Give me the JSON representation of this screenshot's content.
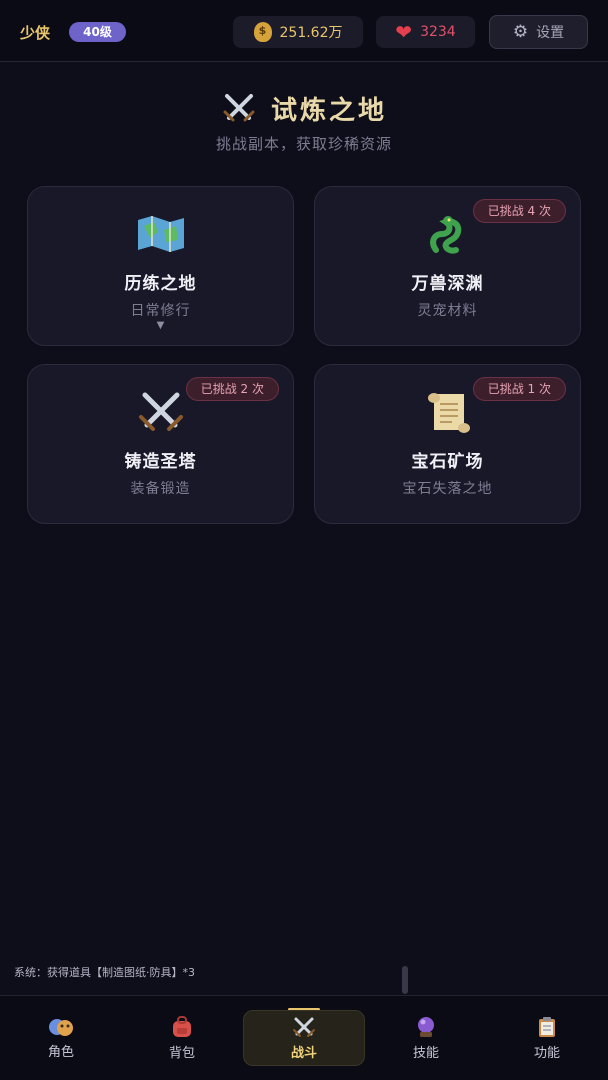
{
  "header": {
    "player_name": "少侠",
    "level": "40级",
    "gold": "251.62万",
    "hp": "3234",
    "settings_label": "设置"
  },
  "page": {
    "title": "试炼之地",
    "subtitle": "挑战副本，获取珍稀资源"
  },
  "cards": [
    {
      "title": "历练之地",
      "subtitle": "日常修行",
      "badge": "",
      "icon": "map-icon",
      "arrow": "▼"
    },
    {
      "title": "万兽深渊",
      "subtitle": "灵宠材料",
      "badge": "已挑战 4 次",
      "icon": "dragon-icon"
    },
    {
      "title": "铸造圣塔",
      "subtitle": "装备锻造",
      "badge": "已挑战 2 次",
      "icon": "crossed-swords-icon"
    },
    {
      "title": "宝石矿场",
      "subtitle": "宝石失落之地",
      "badge": "已挑战 1 次",
      "icon": "scroll-icon"
    }
  ],
  "system_log": "系统：获得道具【制造图纸·防具】*3",
  "nav": [
    {
      "label": "角色",
      "icon": "mask-icon",
      "active": false
    },
    {
      "label": "背包",
      "icon": "backpack-icon",
      "active": false
    },
    {
      "label": "战斗",
      "icon": "crossed-swords-icon",
      "active": true
    },
    {
      "label": "技能",
      "icon": "crystal-ball-icon",
      "active": false
    },
    {
      "label": "功能",
      "icon": "clipboard-icon",
      "active": false
    }
  ],
  "colors": {
    "background": "#0e0e1a",
    "accent_gold": "#e9c66b",
    "level_badge": "#6d63c9",
    "hp_red": "#e2526a",
    "card_bg": "#181828"
  }
}
